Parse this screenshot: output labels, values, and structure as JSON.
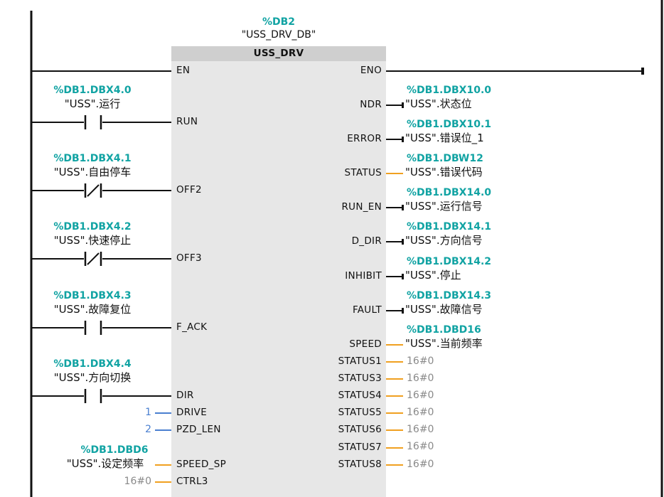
{
  "instance": {
    "db": "%DB2",
    "name": "\"USS_DRV_DB\""
  },
  "block": {
    "name": "USS_DRV"
  },
  "inputs": [
    {
      "pin": "EN"
    },
    {
      "pin": "RUN",
      "address": "%DB1.DBX4.0",
      "symbol": "\"USS\".运行",
      "contact": "NO"
    },
    {
      "pin": "OFF2",
      "address": "%DB1.DBX4.1",
      "symbol": "\"USS\".自由停车",
      "contact": "NC"
    },
    {
      "pin": "OFF3",
      "address": "%DB1.DBX4.2",
      "symbol": "\"USS\".快速停止",
      "contact": "NC"
    },
    {
      "pin": "F_ACK",
      "address": "%DB1.DBX4.3",
      "symbol": "\"USS\".故障复位",
      "contact": "NO"
    },
    {
      "pin": "DIR",
      "address": "%DB1.DBX4.4",
      "symbol": "\"USS\".方向切换",
      "contact": "NO"
    },
    {
      "pin": "DRIVE",
      "value": "1"
    },
    {
      "pin": "PZD_LEN",
      "value": "2"
    },
    {
      "pin": "SPEED_SP",
      "address": "%DB1.DBD6",
      "symbol": "\"USS\".设定频率"
    },
    {
      "pin": "CTRL3",
      "value": "16#0"
    }
  ],
  "outputs": [
    {
      "pin": "ENO"
    },
    {
      "pin": "NDR",
      "address": "%DB1.DBX10.0",
      "symbol": "\"USS\".状态位"
    },
    {
      "pin": "ERROR",
      "address": "%DB1.DBX10.1",
      "symbol": "\"USS\".错误位_1"
    },
    {
      "pin": "STATUS",
      "address": "%DB1.DBW12",
      "symbol": "\"USS\".错误代码"
    },
    {
      "pin": "RUN_EN",
      "address": "%DB1.DBX14.0",
      "symbol": "\"USS\".运行信号"
    },
    {
      "pin": "D_DIR",
      "address": "%DB1.DBX14.1",
      "symbol": "\"USS\".方向信号"
    },
    {
      "pin": "INHIBIT",
      "address": "%DB1.DBX14.2",
      "symbol": "\"USS\".停止"
    },
    {
      "pin": "FAULT",
      "address": "%DB1.DBX14.3",
      "symbol": "\"USS\".故障信号"
    },
    {
      "pin": "SPEED",
      "address": "%DB1.DBD16",
      "symbol": "\"USS\".当前频率"
    },
    {
      "pin": "STATUS1",
      "value": "16#0"
    },
    {
      "pin": "STATUS3",
      "value": "16#0"
    },
    {
      "pin": "STATUS4",
      "value": "16#0"
    },
    {
      "pin": "STATUS5",
      "value": "16#0"
    },
    {
      "pin": "STATUS6",
      "value": "16#0"
    },
    {
      "pin": "STATUS7",
      "value": "16#0"
    },
    {
      "pin": "STATUS8",
      "value": "16#0"
    }
  ],
  "colors": {
    "address": "#11a3a3",
    "wire": "#111111",
    "word_wire": "#f0a020",
    "const": "#4a7fd0",
    "block": "#e7e7e7",
    "block_header": "#cfcfcf"
  }
}
